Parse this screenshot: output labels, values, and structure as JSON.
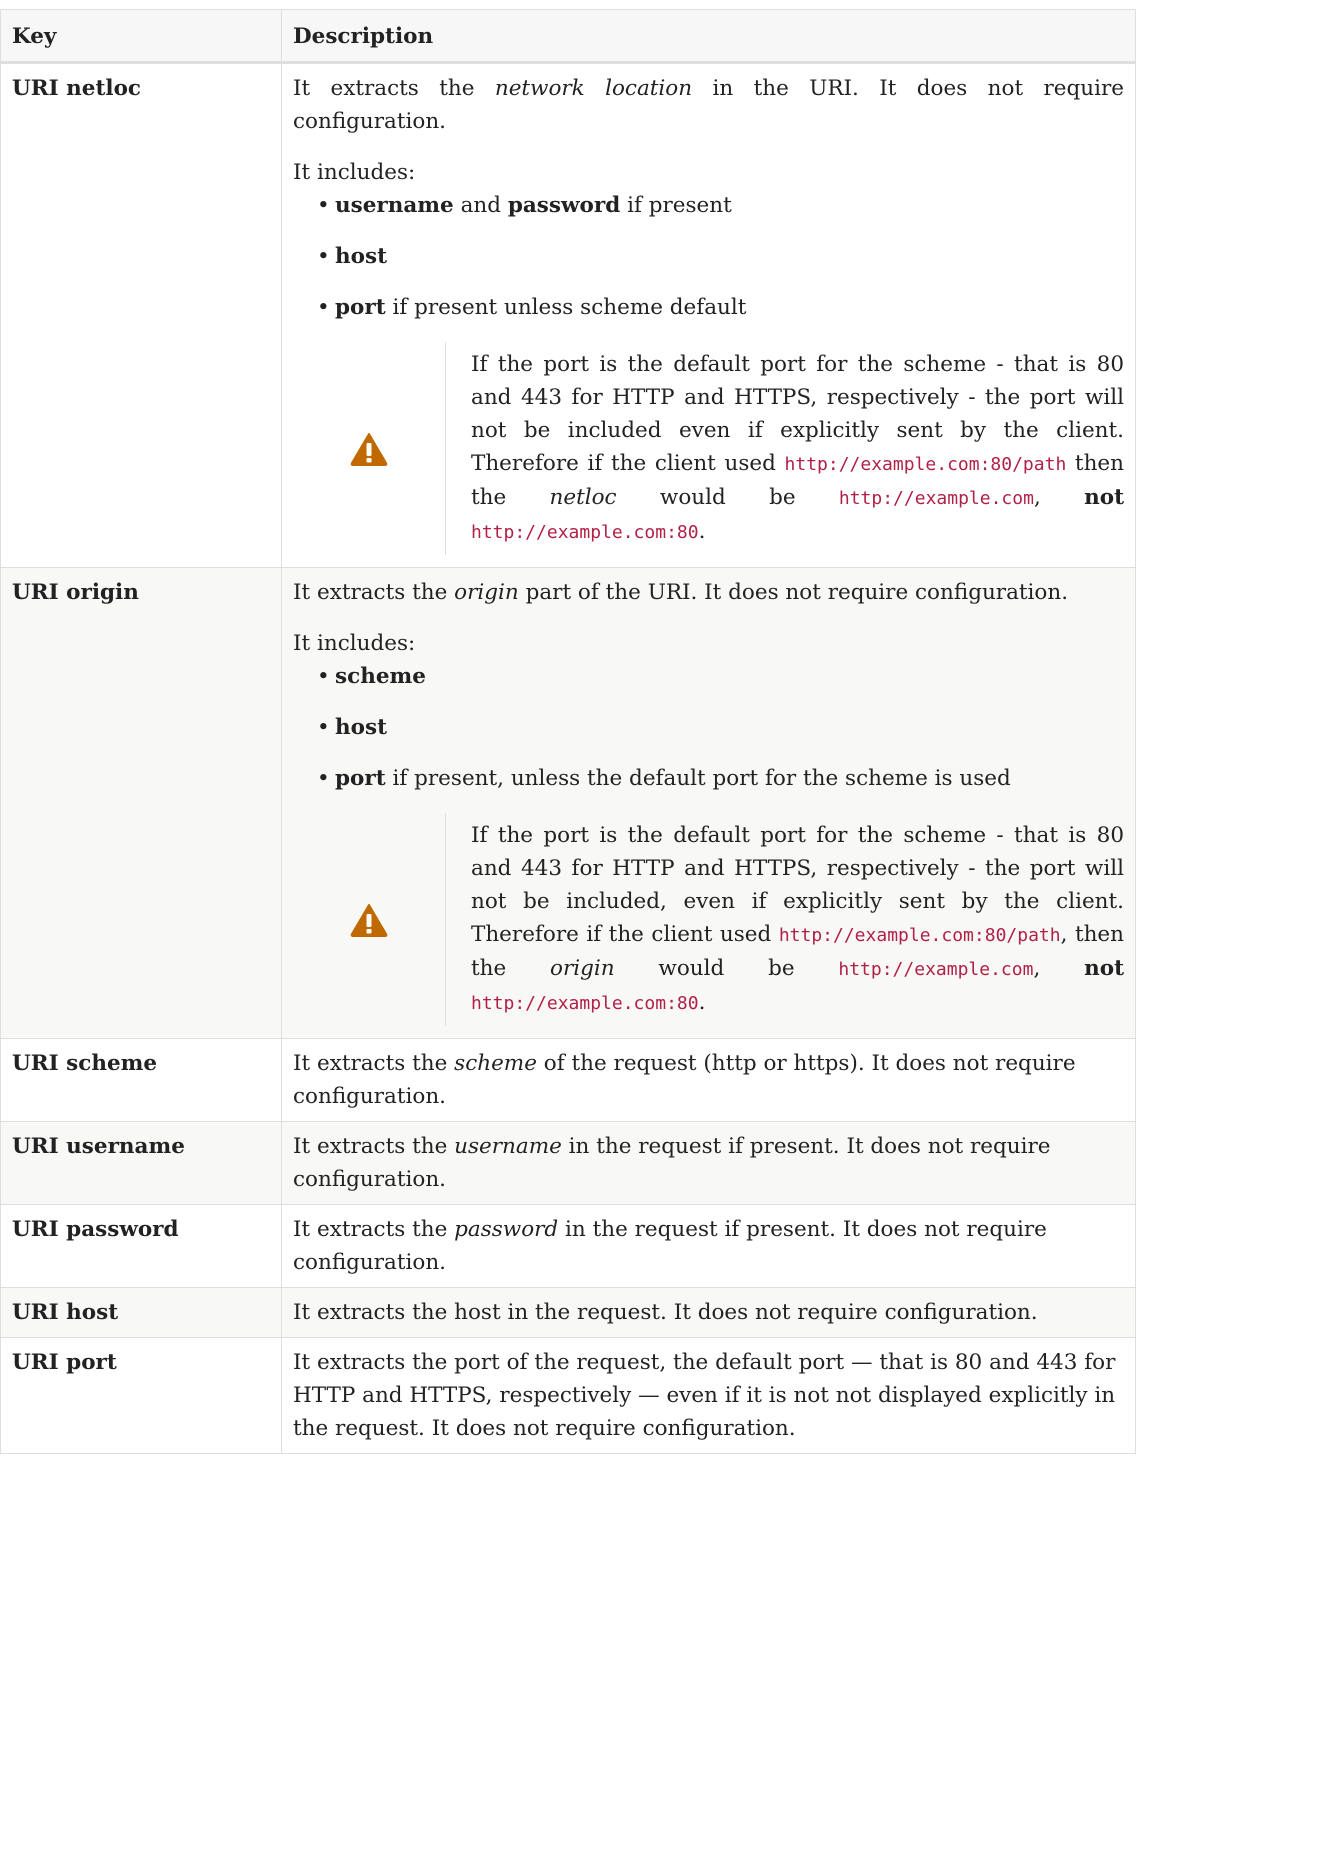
{
  "table": {
    "headers": {
      "key": "Key",
      "description": "Description"
    },
    "rows": {
      "netloc": {
        "key": "URI netloc",
        "intro_pre": "It extracts the ",
        "intro_em": "network location",
        "intro_post": " in the URI. It does not require configuration.",
        "includes": "It includes:",
        "item1_b1": "username",
        "item1_mid": " and ",
        "item1_b2": "password",
        "item1_post": " if present",
        "item2_b": "host",
        "item3_b": "port",
        "item3_post": " if present unless scheme default",
        "warn_t1": "If the port is the default port for the scheme - that is 80 and 443 for HTTP and HTTPS, respectively - the port will not be included even if explicitly sent by the client. Therefore if the client used ",
        "warn_code1": "http://example.com:80/path",
        "warn_t2": " then the ",
        "warn_em": "netloc",
        "warn_t3": " would be ",
        "warn_code2": "http://example.com",
        "warn_t4": ", ",
        "warn_b": "not",
        "warn_t5": " ",
        "warn_code3": "http://example.com:80",
        "warn_t6": "."
      },
      "origin": {
        "key": "URI origin",
        "intro_pre": "It extracts the ",
        "intro_em": "origin",
        "intro_post": " part of the URI. It does not require configuration.",
        "includes": "It includes:",
        "item1_b": "scheme",
        "item2_b": "host",
        "item3_b": "port",
        "item3_post": " if present, unless the default port for the scheme is used",
        "warn_t1": "If the port is the default port for the scheme - that is 80 and 443 for HTTP and HTTPS, respectively - the port will not be included, even if explicitly sent by the client. Therefore if the client used ",
        "warn_code1": "http://example.com:80/path",
        "warn_t2": ", then the ",
        "warn_em": "origin",
        "warn_t3": " would be ",
        "warn_code2": "http://example.com",
        "warn_t4": ", ",
        "warn_b": "not",
        "warn_t5": " ",
        "warn_code3": "http://example.com:80",
        "warn_t6": "."
      },
      "scheme": {
        "key": "URI scheme",
        "pre": "It extracts the ",
        "em": "scheme",
        "post": " of the request (http or https). It does not require configuration."
      },
      "username": {
        "key": "URI username",
        "pre": "It extracts the ",
        "em": "username",
        "post": " in the request if present. It does not require configuration."
      },
      "password": {
        "key": "URI password",
        "pre": "It extracts the ",
        "em": "password",
        "post": " in the request if present. It does not require configuration."
      },
      "host": {
        "key": "URI host",
        "text": "It extracts the host in the request. It does not require configuration."
      },
      "port": {
        "key": "URI port",
        "text": "It extracts the port of the request, the default port — that is 80 and 443 for HTTP and HTTPS, respectively — even if it is not not displayed explicitly in the request. It does not require configuration."
      }
    }
  },
  "icons": {
    "warning": "warning-triangle-icon"
  },
  "colors": {
    "warning_icon": "#bf6900",
    "code_text": "#b12146"
  }
}
